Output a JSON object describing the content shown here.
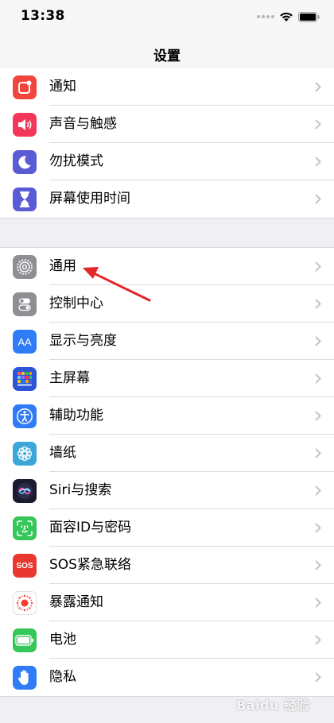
{
  "status_bar": {
    "time": "13:38"
  },
  "nav": {
    "title": "设置"
  },
  "groups": [
    {
      "items": [
        {
          "label": "通知",
          "icon": "notification-icon",
          "color": "#f2453d"
        },
        {
          "label": "声音与触感",
          "icon": "sound-icon",
          "color": "#f2385a"
        },
        {
          "label": "勿扰模式",
          "icon": "moon-icon",
          "color": "#5c5bd6"
        },
        {
          "label": "屏幕使用时间",
          "icon": "hourglass-icon",
          "color": "#5c5bd6"
        }
      ]
    },
    {
      "items": [
        {
          "label": "通用",
          "icon": "gear-icon",
          "color": "#8e8e93"
        },
        {
          "label": "控制中心",
          "icon": "toggles-icon",
          "color": "#8e8e93"
        },
        {
          "label": "显示与亮度",
          "icon": "aa-icon",
          "color": "#2f7cf6"
        },
        {
          "label": "主屏幕",
          "icon": "home-grid-icon",
          "color": "#2d56d6"
        },
        {
          "label": "辅助功能",
          "icon": "accessibility-icon",
          "color": "#2f7cf6"
        },
        {
          "label": "墙纸",
          "icon": "flower-icon",
          "color": "#3aa7d8"
        },
        {
          "label": "Siri与搜索",
          "icon": "siri-icon",
          "color": "#1b1b2e"
        },
        {
          "label": "面容ID与密码",
          "icon": "faceid-icon",
          "color": "#35c759"
        },
        {
          "label": "SOS紧急联络",
          "icon": "sos-icon",
          "color": "#e8382f"
        },
        {
          "label": "暴露通知",
          "icon": "exposure-icon",
          "color": "#ffffff"
        },
        {
          "label": "电池",
          "icon": "battery-icon",
          "color": "#35c759"
        },
        {
          "label": "隐私",
          "icon": "hand-icon",
          "color": "#2f7cf6"
        }
      ]
    }
  ],
  "icon_text": {
    "aa": "AA",
    "sos": "SOS"
  },
  "watermark": "Baidu 经验",
  "annotation_color": "#e3262a"
}
